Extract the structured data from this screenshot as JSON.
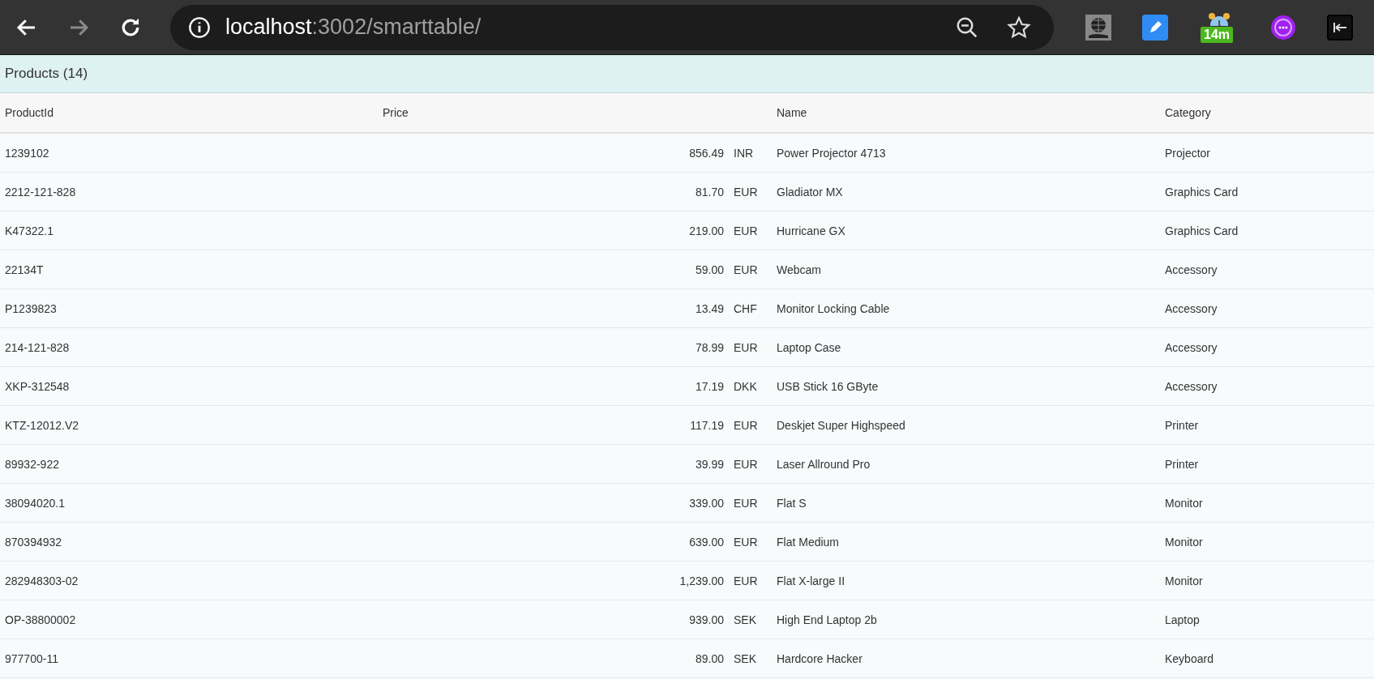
{
  "browser": {
    "url_host": "localhost",
    "url_path": ":3002/smarttable/",
    "forward_disabled": true,
    "extension_badge": "14m"
  },
  "title": "Products (14)",
  "table": {
    "columns": [
      "ProductId",
      "Price",
      "Name",
      "Category"
    ],
    "rows": [
      {
        "id": "1239102",
        "price": "856.49",
        "currency": "INR",
        "name": "Power Projector 4713",
        "category": "Projector"
      },
      {
        "id": "2212-121-828",
        "price": "81.70",
        "currency": "EUR",
        "name": "Gladiator MX",
        "category": "Graphics Card"
      },
      {
        "id": "K47322.1",
        "price": "219.00",
        "currency": "EUR",
        "name": "Hurricane GX",
        "category": "Graphics Card"
      },
      {
        "id": "22134T",
        "price": "59.00",
        "currency": "EUR",
        "name": "Webcam",
        "category": "Accessory"
      },
      {
        "id": "P1239823",
        "price": "13.49",
        "currency": "CHF",
        "name": "Monitor Locking Cable",
        "category": "Accessory"
      },
      {
        "id": "214-121-828",
        "price": "78.99",
        "currency": "EUR",
        "name": "Laptop Case",
        "category": "Accessory"
      },
      {
        "id": "XKP-312548",
        "price": "17.19",
        "currency": "DKK",
        "name": "USB Stick 16 GByte",
        "category": "Accessory"
      },
      {
        "id": "KTZ-12012.V2",
        "price": "117.19",
        "currency": "EUR",
        "name": "Deskjet Super Highspeed",
        "category": "Printer"
      },
      {
        "id": "89932-922",
        "price": "39.99",
        "currency": "EUR",
        "name": "Laser Allround Pro",
        "category": "Printer"
      },
      {
        "id": "38094020.1",
        "price": "339.00",
        "currency": "EUR",
        "name": "Flat S",
        "category": "Monitor"
      },
      {
        "id": "870394932",
        "price": "639.00",
        "currency": "EUR",
        "name": "Flat Medium",
        "category": "Monitor"
      },
      {
        "id": "282948303-02",
        "price": "1,239.00",
        "currency": "EUR",
        "name": "Flat X-large II",
        "category": "Monitor"
      },
      {
        "id": "OP-38800002",
        "price": "939.00",
        "currency": "SEK",
        "name": "High End Laptop 2b",
        "category": "Laptop"
      },
      {
        "id": "977700-11",
        "price": "89.00",
        "currency": "SEK",
        "name": "Hardcore Hacker",
        "category": "Keyboard"
      }
    ]
  }
}
